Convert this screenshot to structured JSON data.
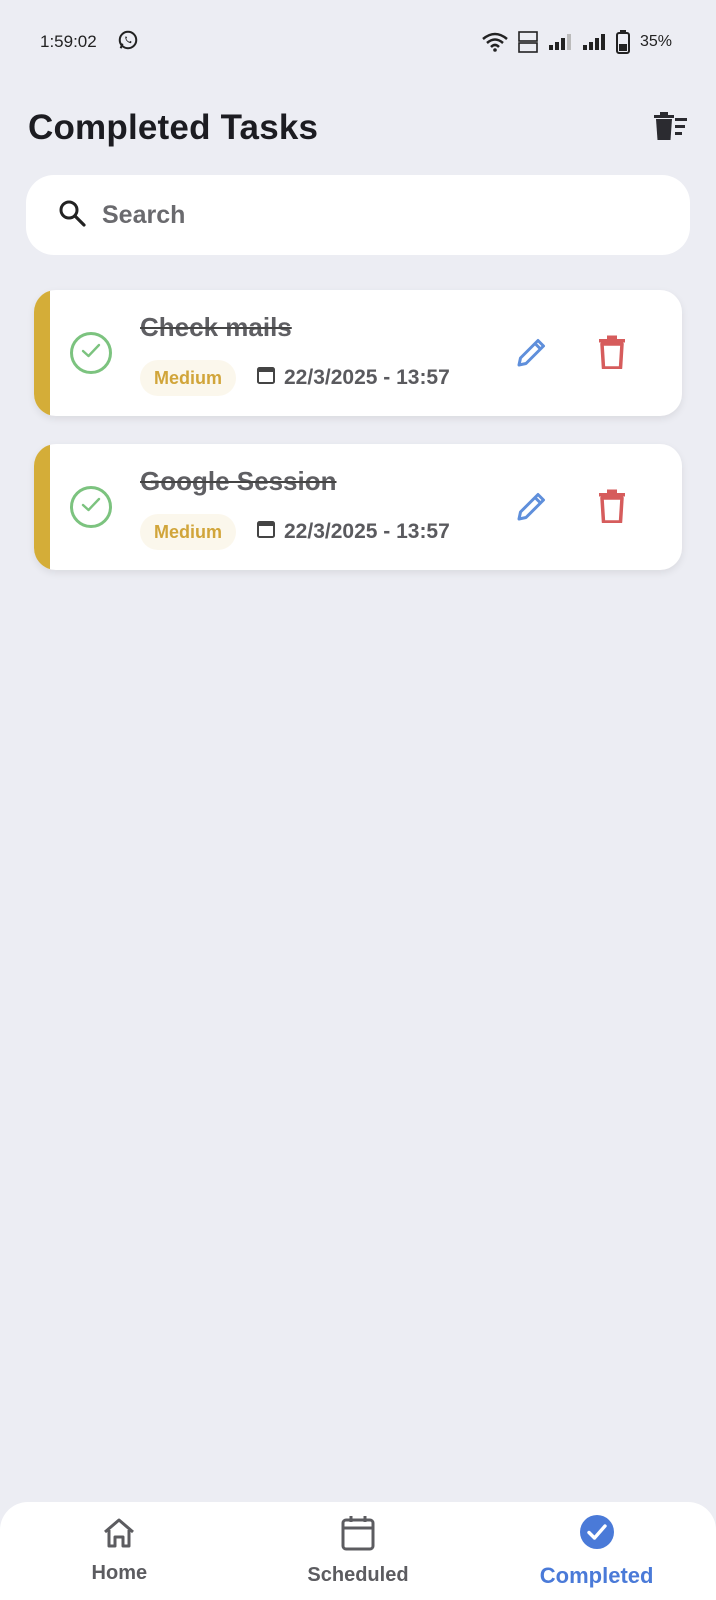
{
  "status_bar": {
    "time": "1:59:02",
    "battery": "35%"
  },
  "header": {
    "title": "Completed Tasks",
    "clear_icon": "trash-clear-icon"
  },
  "search": {
    "placeholder": "Search",
    "value": ""
  },
  "tasks": [
    {
      "title": "Check mails",
      "priority": "Medium",
      "datetime": "22/3/2025 - 13:57",
      "priority_color": "#d4ad38"
    },
    {
      "title": "Google Session",
      "priority": "Medium",
      "datetime": "22/3/2025 - 13:57",
      "priority_color": "#d4ad38"
    }
  ],
  "bottom_nav": {
    "items": [
      {
        "label": "Home",
        "icon": "home-icon"
      },
      {
        "label": "Scheduled",
        "icon": "calendar-icon"
      },
      {
        "label": "Completed",
        "icon": "check-circle-icon",
        "active": true
      }
    ]
  },
  "colors": {
    "background": "#ecedf3",
    "accent": "#4a7ad8",
    "completed_green": "#7cc37f",
    "delete_red": "#d65c5c",
    "edit_blue": "#5f8fdb"
  }
}
